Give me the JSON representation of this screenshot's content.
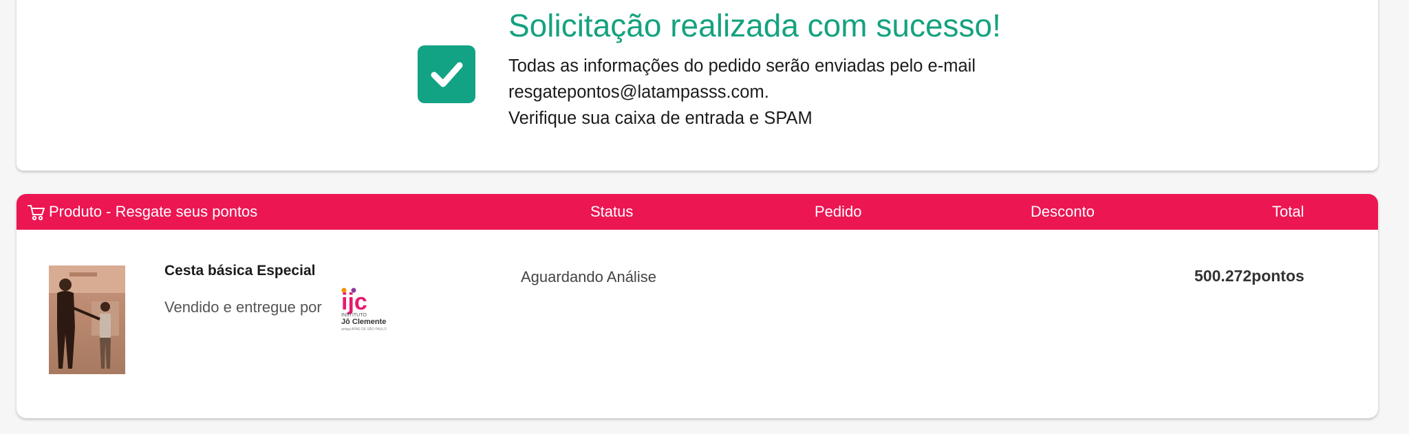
{
  "success": {
    "title": "Solicitação realizada com sucesso!",
    "line1": "Todas as informações do pedido serão enviadas pelo e-mail",
    "line2": "resgatepontos@latampasss.com.",
    "line3": "Verifique sua caixa de entrada e SPAM",
    "icon": "check-icon",
    "accent": "#12a385"
  },
  "order": {
    "header_color": "#ec1652",
    "columns": {
      "product": "Produto - Resgate seus pontos",
      "status": "Status",
      "pedido": "Pedido",
      "desconto": "Desconto",
      "total": "Total"
    },
    "item": {
      "name": "Cesta básica Especial",
      "sold_by": "Vendido e entregue por",
      "status": "Aguardando Análise",
      "total": "500.272pontos",
      "partner_logo": {
        "acronym": "ijc",
        "line1": "INSTITUTO",
        "line2": "Jô Clemente",
        "line3": "antiga APAE DE SÃO PAULO"
      }
    }
  }
}
